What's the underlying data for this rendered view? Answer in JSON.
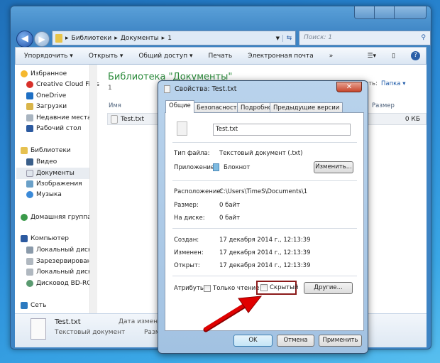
{
  "explorer": {
    "breadcrumb": [
      "Библиотеки",
      "Документы",
      "1"
    ],
    "search_placeholder": "Поиск: 1",
    "toolbar": {
      "organize": "Упорядочить ▾",
      "open": "Открыть ▾",
      "share": "Общий доступ ▾",
      "print": "Печать",
      "email": "Электронная почта",
      "more": "»"
    },
    "nav": {
      "favorites": "Избранное",
      "items_fav": [
        "Creative Cloud Files",
        "OneDrive",
        "Загрузки",
        "Недавние места",
        "Рабочий стол"
      ],
      "libraries": "Библиотеки",
      "items_lib": [
        "Видео",
        "Документы",
        "Изображения",
        "Музыка"
      ],
      "homegroup": "Домашняя группа",
      "computer": "Компьютер",
      "items_comp": [
        "Локальный диск",
        "Зарезервировано",
        "Локальный диск",
        "Дисковод BD-ROM"
      ],
      "network": "Сеть"
    },
    "library_title": "Библиотека \"Документы\"",
    "library_sub": "1",
    "arrange_label": "Упорядочить:",
    "arrange_value": "Папка ▾",
    "columns": {
      "name": "Имя",
      "size": "Размер"
    },
    "files": [
      {
        "name": "Test.txt",
        "size": "0 КБ"
      }
    ],
    "details": {
      "name": "Test.txt",
      "type": "Текстовый документ",
      "date_label": "Дата изменения",
      "size_label": "Размер"
    }
  },
  "dialog": {
    "title": "Свойства: Test.txt",
    "tabs": [
      "Общие",
      "Безопасность",
      "Подробно",
      "Предыдущие версии"
    ],
    "filename": "Test.txt",
    "type_label": "Тип файла:",
    "type_value": "Текстовый документ (.txt)",
    "app_label": "Приложение:",
    "app_value": "Блокнот",
    "change_btn": "Изменить...",
    "location_label": "Расположение:",
    "location_value": "C:\\Users\\TimeS\\Documents\\1",
    "size_label": "Размер:",
    "size_value": "0 байт",
    "disk_label": "На диске:",
    "disk_value": "0 байт",
    "created_label": "Создан:",
    "created_value": "17 декабря 2014 г., 12:13:39",
    "modified_label": "Изменен:",
    "modified_value": "17 декабря 2014 г., 12:13:39",
    "opened_label": "Открыт:",
    "opened_value": "17 декабря 2014 г., 12:13:39",
    "attr_label": "Атрибуты:",
    "readonly": "Только чтение",
    "hidden": "Скрытый",
    "other_btn": "Другие...",
    "readonly_checked": false,
    "hidden_checked": false,
    "ok": "OK",
    "cancel": "Отмена",
    "apply": "Применить",
    "highlight_color": "#8b1a1a",
    "arrow_color": "#e00000"
  }
}
